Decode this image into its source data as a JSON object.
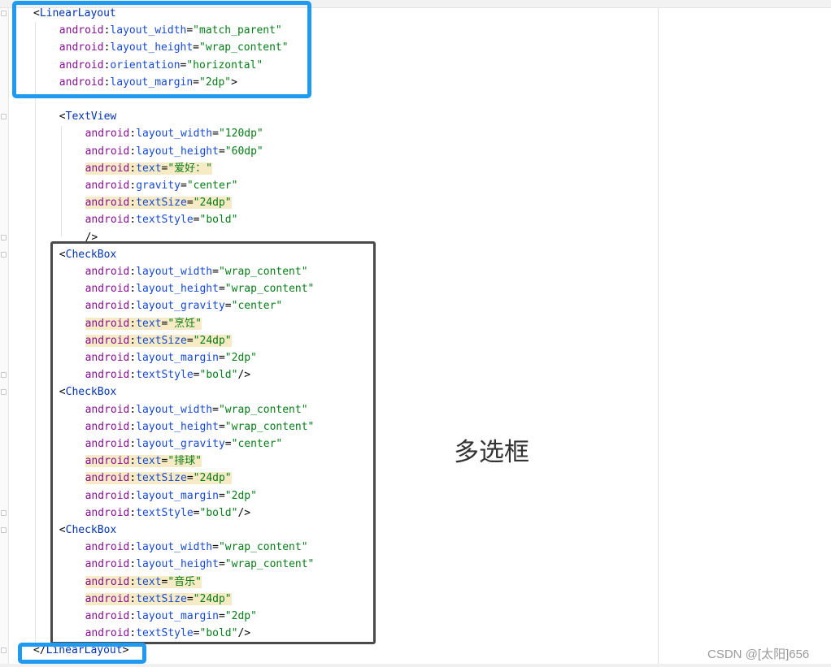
{
  "code_lines": [
    {
      "type": "open_tag",
      "tag": "LinearLayout"
    },
    {
      "type": "attr",
      "name": "layout_width",
      "value": "match_parent"
    },
    {
      "type": "attr",
      "name": "layout_height",
      "value": "wrap_content"
    },
    {
      "type": "attr",
      "name": "orientation",
      "value": "horizontal"
    },
    {
      "type": "attr",
      "name": "layout_margin",
      "value": "2dp",
      "suffix": ">"
    },
    {
      "type": "blank"
    },
    {
      "type": "open_tag",
      "tag": "TextView"
    },
    {
      "type": "attr",
      "name": "layout_width",
      "value": "120dp"
    },
    {
      "type": "attr",
      "name": "layout_height",
      "value": "60dp"
    },
    {
      "type": "attr",
      "name": "text",
      "value": "爱好：",
      "hl": true
    },
    {
      "type": "attr",
      "name": "gravity",
      "value": "center"
    },
    {
      "type": "attr",
      "name": "textSize",
      "value": "24dp",
      "hl": true
    },
    {
      "type": "attr",
      "name": "textStyle",
      "value": "bold"
    },
    {
      "type": "self_close",
      "text": "/>"
    },
    {
      "type": "open_tag",
      "tag": "CheckBox"
    },
    {
      "type": "attr",
      "name": "layout_width",
      "value": "wrap_content"
    },
    {
      "type": "attr",
      "name": "layout_height",
      "value": "wrap_content"
    },
    {
      "type": "attr",
      "name": "layout_gravity",
      "value": "center"
    },
    {
      "type": "attr",
      "name": "text",
      "value": "烹饪",
      "hl": true
    },
    {
      "type": "attr",
      "name": "textSize",
      "value": "24dp",
      "hl": true
    },
    {
      "type": "attr",
      "name": "layout_margin",
      "value": "2dp"
    },
    {
      "type": "attr",
      "name": "textStyle",
      "value": "bold",
      "suffix": "/>"
    },
    {
      "type": "open_tag",
      "tag": "CheckBox"
    },
    {
      "type": "attr",
      "name": "layout_width",
      "value": "wrap_content"
    },
    {
      "type": "attr",
      "name": "layout_height",
      "value": "wrap_content"
    },
    {
      "type": "attr",
      "name": "layout_gravity",
      "value": "center"
    },
    {
      "type": "attr",
      "name": "text",
      "value": "排球",
      "hl": true
    },
    {
      "type": "attr",
      "name": "textSize",
      "value": "24dp",
      "hl": true
    },
    {
      "type": "attr",
      "name": "layout_margin",
      "value": "2dp"
    },
    {
      "type": "attr",
      "name": "textStyle",
      "value": "bold",
      "suffix": "/>"
    },
    {
      "type": "open_tag",
      "tag": "CheckBox"
    },
    {
      "type": "attr",
      "name": "layout_width",
      "value": "wrap_content"
    },
    {
      "type": "attr",
      "name": "layout_height",
      "value": "wrap_content"
    },
    {
      "type": "attr",
      "name": "text",
      "value": "音乐",
      "hl": true
    },
    {
      "type": "attr",
      "name": "textSize",
      "value": "24dp",
      "hl": true
    },
    {
      "type": "attr",
      "name": "layout_margin",
      "value": "2dp"
    },
    {
      "type": "attr",
      "name": "textStyle",
      "value": "bold",
      "suffix": "/>"
    },
    {
      "type": "close_tag",
      "tag": "LinearLayout"
    }
  ],
  "namespace": "android",
  "annotation": "多选框",
  "watermark": "CSDN @[太阳]656",
  "colors": {
    "highlight_box": "#1e9bf0",
    "group_box": "#4a4a4a",
    "tag": "#0033b3",
    "namespace": "#871094",
    "attribute": "#174ad4",
    "value": "#067d17",
    "search_highlight": "#f7ebc6"
  }
}
